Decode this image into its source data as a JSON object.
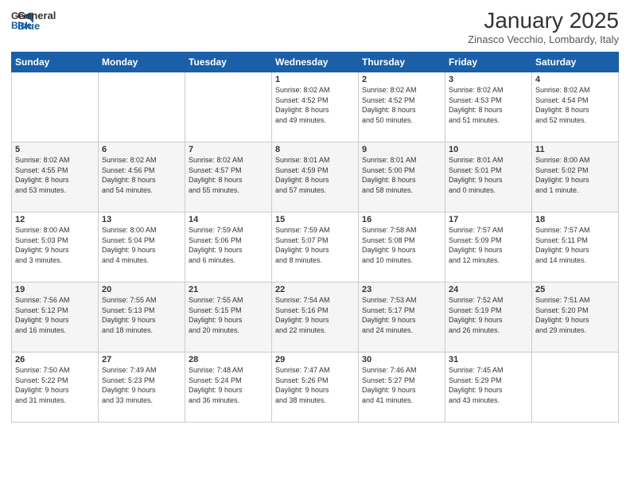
{
  "header": {
    "logo_general": "General",
    "logo_blue": "Blue",
    "month_title": "January 2025",
    "location": "Zinasco Vecchio, Lombardy, Italy"
  },
  "weekdays": [
    "Sunday",
    "Monday",
    "Tuesday",
    "Wednesday",
    "Thursday",
    "Friday",
    "Saturday"
  ],
  "weeks": [
    [
      {
        "day": "",
        "info": ""
      },
      {
        "day": "",
        "info": ""
      },
      {
        "day": "",
        "info": ""
      },
      {
        "day": "1",
        "info": "Sunrise: 8:02 AM\nSunset: 4:52 PM\nDaylight: 8 hours\nand 49 minutes."
      },
      {
        "day": "2",
        "info": "Sunrise: 8:02 AM\nSunset: 4:52 PM\nDaylight: 8 hours\nand 50 minutes."
      },
      {
        "day": "3",
        "info": "Sunrise: 8:02 AM\nSunset: 4:53 PM\nDaylight: 8 hours\nand 51 minutes."
      },
      {
        "day": "4",
        "info": "Sunrise: 8:02 AM\nSunset: 4:54 PM\nDaylight: 8 hours\nand 52 minutes."
      }
    ],
    [
      {
        "day": "5",
        "info": "Sunrise: 8:02 AM\nSunset: 4:55 PM\nDaylight: 8 hours\nand 53 minutes."
      },
      {
        "day": "6",
        "info": "Sunrise: 8:02 AM\nSunset: 4:56 PM\nDaylight: 8 hours\nand 54 minutes."
      },
      {
        "day": "7",
        "info": "Sunrise: 8:02 AM\nSunset: 4:57 PM\nDaylight: 8 hours\nand 55 minutes."
      },
      {
        "day": "8",
        "info": "Sunrise: 8:01 AM\nSunset: 4:59 PM\nDaylight: 8 hours\nand 57 minutes."
      },
      {
        "day": "9",
        "info": "Sunrise: 8:01 AM\nSunset: 5:00 PM\nDaylight: 8 hours\nand 58 minutes."
      },
      {
        "day": "10",
        "info": "Sunrise: 8:01 AM\nSunset: 5:01 PM\nDaylight: 9 hours\nand 0 minutes."
      },
      {
        "day": "11",
        "info": "Sunrise: 8:00 AM\nSunset: 5:02 PM\nDaylight: 9 hours\nand 1 minute."
      }
    ],
    [
      {
        "day": "12",
        "info": "Sunrise: 8:00 AM\nSunset: 5:03 PM\nDaylight: 9 hours\nand 3 minutes."
      },
      {
        "day": "13",
        "info": "Sunrise: 8:00 AM\nSunset: 5:04 PM\nDaylight: 9 hours\nand 4 minutes."
      },
      {
        "day": "14",
        "info": "Sunrise: 7:59 AM\nSunset: 5:06 PM\nDaylight: 9 hours\nand 6 minutes."
      },
      {
        "day": "15",
        "info": "Sunrise: 7:59 AM\nSunset: 5:07 PM\nDaylight: 9 hours\nand 8 minutes."
      },
      {
        "day": "16",
        "info": "Sunrise: 7:58 AM\nSunset: 5:08 PM\nDaylight: 9 hours\nand 10 minutes."
      },
      {
        "day": "17",
        "info": "Sunrise: 7:57 AM\nSunset: 5:09 PM\nDaylight: 9 hours\nand 12 minutes."
      },
      {
        "day": "18",
        "info": "Sunrise: 7:57 AM\nSunset: 5:11 PM\nDaylight: 9 hours\nand 14 minutes."
      }
    ],
    [
      {
        "day": "19",
        "info": "Sunrise: 7:56 AM\nSunset: 5:12 PM\nDaylight: 9 hours\nand 16 minutes."
      },
      {
        "day": "20",
        "info": "Sunrise: 7:55 AM\nSunset: 5:13 PM\nDaylight: 9 hours\nand 18 minutes."
      },
      {
        "day": "21",
        "info": "Sunrise: 7:55 AM\nSunset: 5:15 PM\nDaylight: 9 hours\nand 20 minutes."
      },
      {
        "day": "22",
        "info": "Sunrise: 7:54 AM\nSunset: 5:16 PM\nDaylight: 9 hours\nand 22 minutes."
      },
      {
        "day": "23",
        "info": "Sunrise: 7:53 AM\nSunset: 5:17 PM\nDaylight: 9 hours\nand 24 minutes."
      },
      {
        "day": "24",
        "info": "Sunrise: 7:52 AM\nSunset: 5:19 PM\nDaylight: 9 hours\nand 26 minutes."
      },
      {
        "day": "25",
        "info": "Sunrise: 7:51 AM\nSunset: 5:20 PM\nDaylight: 9 hours\nand 29 minutes."
      }
    ],
    [
      {
        "day": "26",
        "info": "Sunrise: 7:50 AM\nSunset: 5:22 PM\nDaylight: 9 hours\nand 31 minutes."
      },
      {
        "day": "27",
        "info": "Sunrise: 7:49 AM\nSunset: 5:23 PM\nDaylight: 9 hours\nand 33 minutes."
      },
      {
        "day": "28",
        "info": "Sunrise: 7:48 AM\nSunset: 5:24 PM\nDaylight: 9 hours\nand 36 minutes."
      },
      {
        "day": "29",
        "info": "Sunrise: 7:47 AM\nSunset: 5:26 PM\nDaylight: 9 hours\nand 38 minutes."
      },
      {
        "day": "30",
        "info": "Sunrise: 7:46 AM\nSunset: 5:27 PM\nDaylight: 9 hours\nand 41 minutes."
      },
      {
        "day": "31",
        "info": "Sunrise: 7:45 AM\nSunset: 5:29 PM\nDaylight: 9 hours\nand 43 minutes."
      },
      {
        "day": "",
        "info": ""
      }
    ]
  ]
}
